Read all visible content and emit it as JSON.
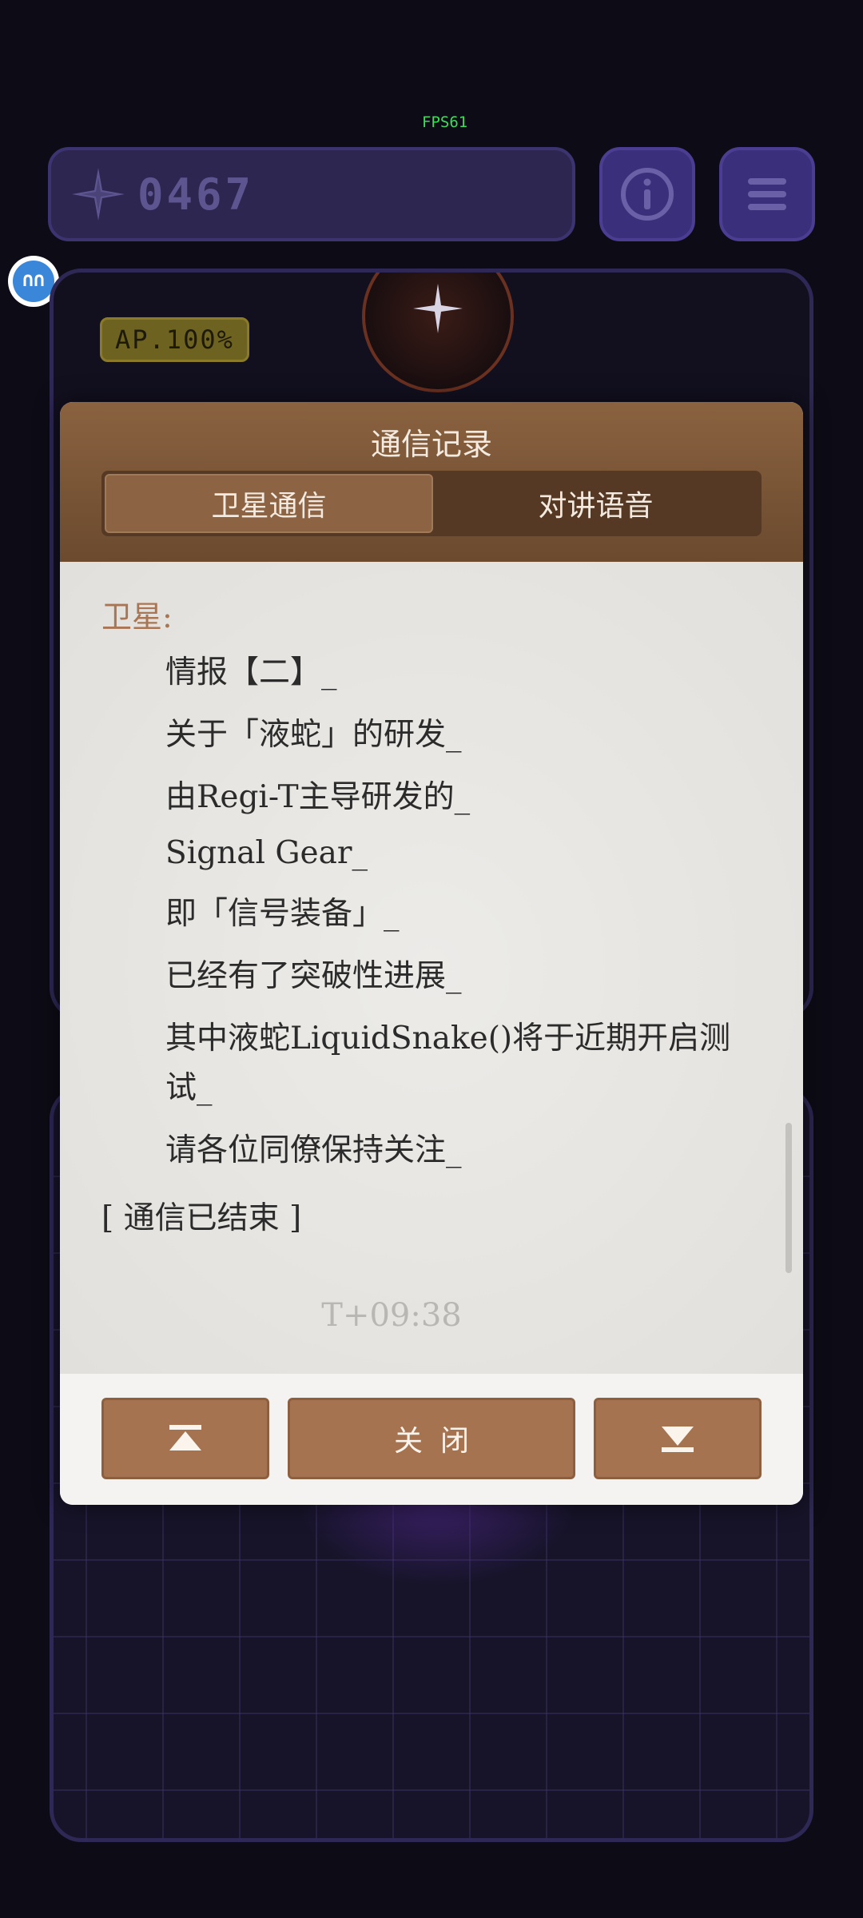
{
  "fps": "FPS61",
  "hud": {
    "score": "0467",
    "ap_badge": "AP.100%"
  },
  "modal": {
    "title": "通信记录",
    "tabs": [
      {
        "label": "卫星通信",
        "active": true
      },
      {
        "label": "对讲语音",
        "active": false
      }
    ],
    "speaker": "卫星:",
    "lines": [
      "情报【二】_",
      "关于「液蛇」的研发_",
      "由Regi-T主导研发的_",
      "Signal Gear_",
      "即「信号装备」_",
      "已经有了突破性进展_",
      "其中液蛇LiquidSnake()将于近期开启测",
      "试_",
      "请各位同僚保持关注_"
    ],
    "end_text": "[ 通信已结束 ]",
    "timestamp": "T+09:38",
    "buttons": {
      "top_icon": "scroll-to-top-icon",
      "close": "关闭",
      "bottom_icon": "scroll-to-bottom-icon"
    }
  },
  "colors": {
    "accent_brown": "#a5734f",
    "header_brown": "#7a5537",
    "hud_purple": "#3a2f7a"
  }
}
